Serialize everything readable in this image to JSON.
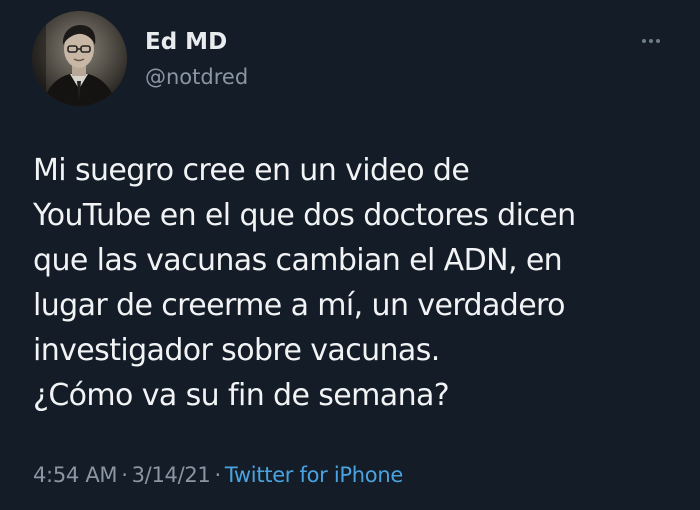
{
  "tweet": {
    "author": {
      "display_name": "Ed MD",
      "handle": "@notdred",
      "avatar_icon": "profile-photo"
    },
    "more_icon": "ellipsis-icon",
    "text_lines": [
      "Mi suegro cree en un video de",
      "YouTube en el que dos doctores dicen",
      "que las vacunas cambian el ADN, en",
      "lugar de creerme a mí, un verdadero",
      "investigador sobre vacunas.",
      "¿Cómo va su fin de semana?"
    ],
    "time": "4:54 AM",
    "date": "3/14/21",
    "separator": "·",
    "source": "Twitter for iPhone"
  },
  "colors": {
    "background": "#141c27",
    "name": "#e9ecef",
    "muted": "#8a96a3",
    "text": "#f1f3f5",
    "link": "#4aa3e0"
  }
}
